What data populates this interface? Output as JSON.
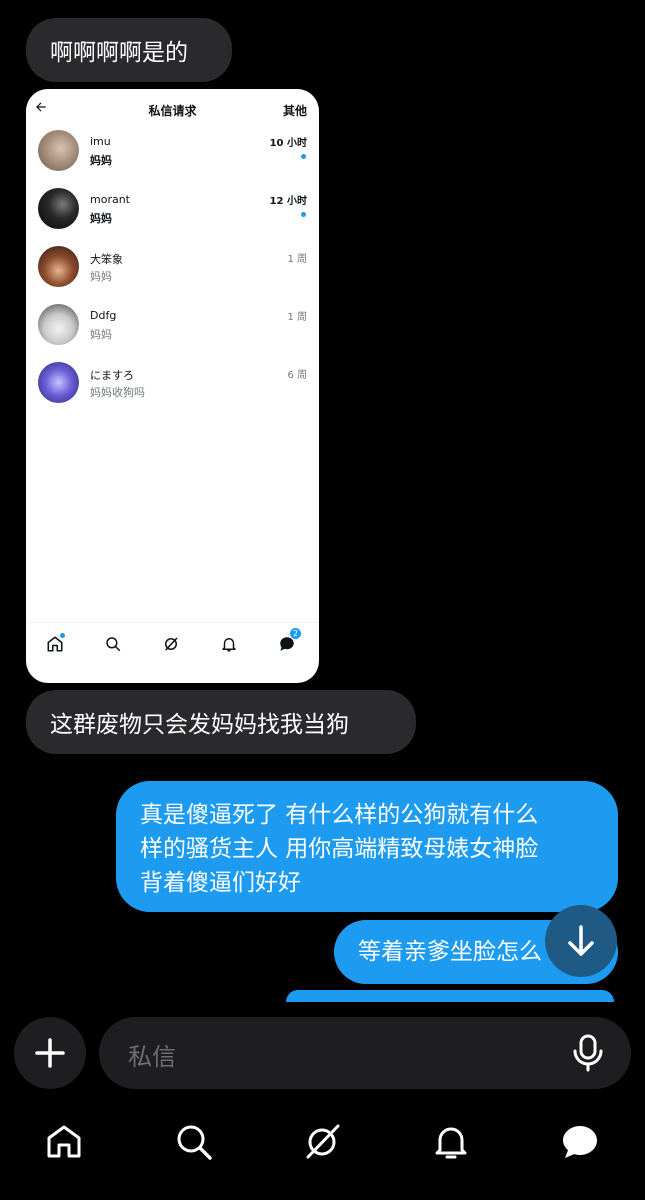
{
  "messages": {
    "incoming_1": "啊啊啊啊是的",
    "incoming_2": "这群废物只会发妈妈找我当狗",
    "outgoing_1": [
      "真是傻逼死了 有什么样的公狗就有什么",
      "样的骚货主人 用你高端精致母婊女神脸",
      "背着傻逼们好好"
    ],
    "outgoing_2": "等着亲爹坐脸怎么"
  },
  "shared_screenshot": {
    "title": "私信请求",
    "right_action": "其他",
    "requests": [
      {
        "name": "imu",
        "message": "妈妈",
        "time": "10 小时",
        "unread": true
      },
      {
        "name": "morant",
        "message": "妈妈",
        "time": "12 小时",
        "unread": true
      },
      {
        "name": "大笨象",
        "message": "妈妈",
        "time": "1 周",
        "unread": false
      },
      {
        "name": "Ddfg",
        "message": "妈妈",
        "time": "1 周",
        "unread": false
      },
      {
        "name": "にますろ",
        "message": "妈妈收狗吗",
        "time": "6 周",
        "unread": false
      }
    ],
    "messages_badge": "2"
  },
  "composer": {
    "placeholder": "私信"
  },
  "icons": {
    "add": "plus-icon",
    "mic": "microphone-icon",
    "scroll": "arrow-down-icon",
    "nav": [
      "home-icon",
      "search-icon",
      "grok-icon",
      "bell-icon",
      "messages-icon"
    ]
  },
  "colors": {
    "accent": "#1d9bf0",
    "incoming_bubble": "#2a2a2d",
    "background": "#000000"
  }
}
